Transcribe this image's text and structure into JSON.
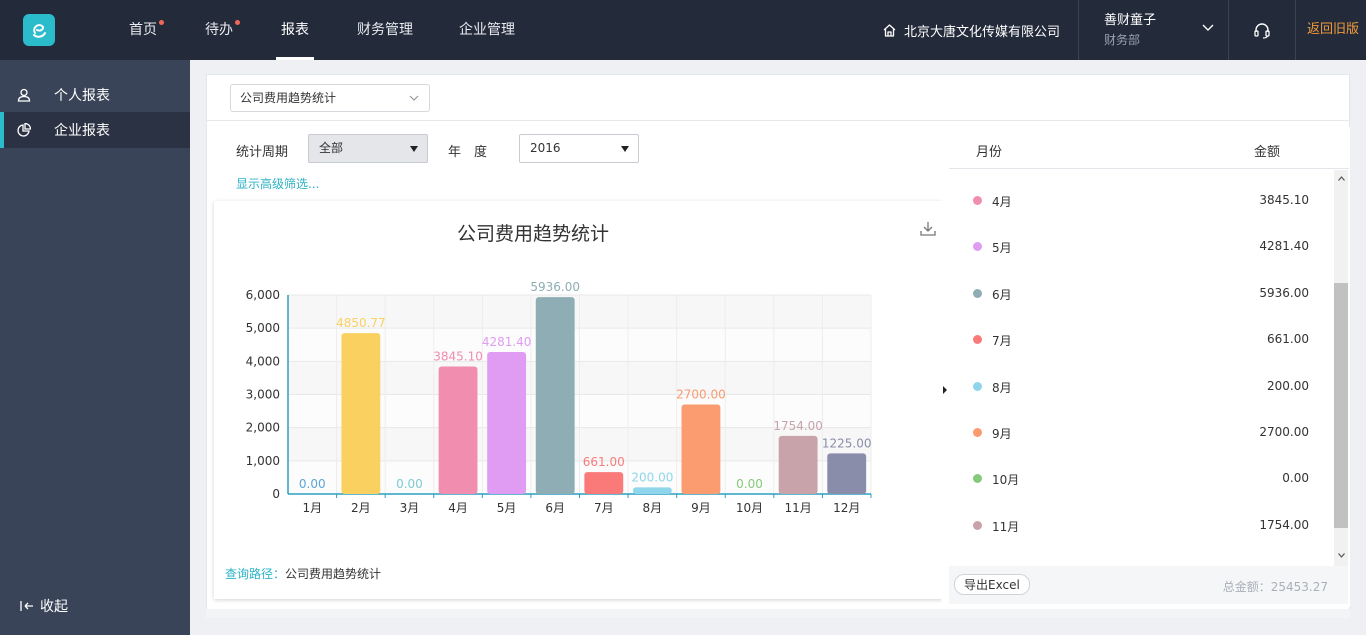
{
  "topbar": {
    "nav": [
      {
        "label": "首页",
        "dot": true
      },
      {
        "label": "待办",
        "dot": true
      },
      {
        "label": "报表",
        "dot": false,
        "active": true
      },
      {
        "label": "财务管理",
        "dot": false
      },
      {
        "label": "企业管理",
        "dot": false
      }
    ],
    "company": "北京大唐文化传媒有限公司",
    "user_name": "善财童子",
    "user_dept": "财务部",
    "old_version": "返回旧版",
    "colors": {
      "bg": "#232a3a",
      "accent": "#2bbccc",
      "badge": "#f2675a",
      "old_version": "#f39b3a"
    }
  },
  "sidebar": {
    "items": [
      {
        "label": "个人报表",
        "icon": "user-icon",
        "active": false
      },
      {
        "label": "企业报表",
        "icon": "pie-chart-icon",
        "active": true
      }
    ],
    "collapse_label": "收起"
  },
  "main": {
    "report_select": "公司费用趋势统计",
    "filters": {
      "period_label": "统计周期",
      "period_value": "全部",
      "year_label": "年　度",
      "year_value": "2016",
      "advanced_link": "显示高级筛选..."
    },
    "query_path_label": "查询路径：",
    "query_path_value": "公司费用趋势统计"
  },
  "chart_data": {
    "type": "bar",
    "title": "公司费用趋势统计",
    "xlabel": "",
    "ylabel": "",
    "ylim": [
      0,
      6000
    ],
    "yticks": [
      "0",
      "1,000",
      "2,000",
      "3,000",
      "4,000",
      "5,000",
      "6,000"
    ],
    "categories": [
      "1月",
      "2月",
      "3月",
      "4月",
      "5月",
      "6月",
      "7月",
      "8月",
      "9月",
      "10月",
      "11月",
      "12月"
    ],
    "values": [
      0,
      4850.77,
      0,
      3845.1,
      4281.4,
      5936.0,
      661.0,
      200.0,
      2700.0,
      0,
      1754.0,
      1225.0
    ],
    "data_labels": [
      "0.00",
      "4850.77",
      "0.00",
      "3845.10",
      "4281.40",
      "5936.00",
      "661.00",
      "200.00",
      "2700.00",
      "0.00",
      "1754.00",
      "1225.00"
    ],
    "colors": [
      "#5aa6d8",
      "#fad161",
      "#7ecbd4",
      "#f18daf",
      "#df9cf2",
      "#8eadb5",
      "#fa7a7a",
      "#8fd6ec",
      "#fa9b70",
      "#85c97a",
      "#c9a3aa",
      "#8a8da9"
    ],
    "grid": true,
    "legend": "none"
  },
  "table": {
    "headers": {
      "month": "月份",
      "amount": "金额"
    },
    "rows": [
      {
        "month": "4月",
        "amount": "3845.10",
        "color": "#f18daf"
      },
      {
        "month": "5月",
        "amount": "4281.40",
        "color": "#df9cf2"
      },
      {
        "month": "6月",
        "amount": "5936.00",
        "color": "#8eadb5"
      },
      {
        "month": "7月",
        "amount": "661.00",
        "color": "#fa7a7a"
      },
      {
        "month": "8月",
        "amount": "200.00",
        "color": "#8fd6ec"
      },
      {
        "month": "9月",
        "amount": "2700.00",
        "color": "#fa9b70"
      },
      {
        "month": "10月",
        "amount": "0.00",
        "color": "#85c97a"
      },
      {
        "month": "11月",
        "amount": "1754.00",
        "color": "#c9a3aa"
      }
    ],
    "export_label": "导出Excel",
    "total_label": "总金额：25453.27"
  }
}
